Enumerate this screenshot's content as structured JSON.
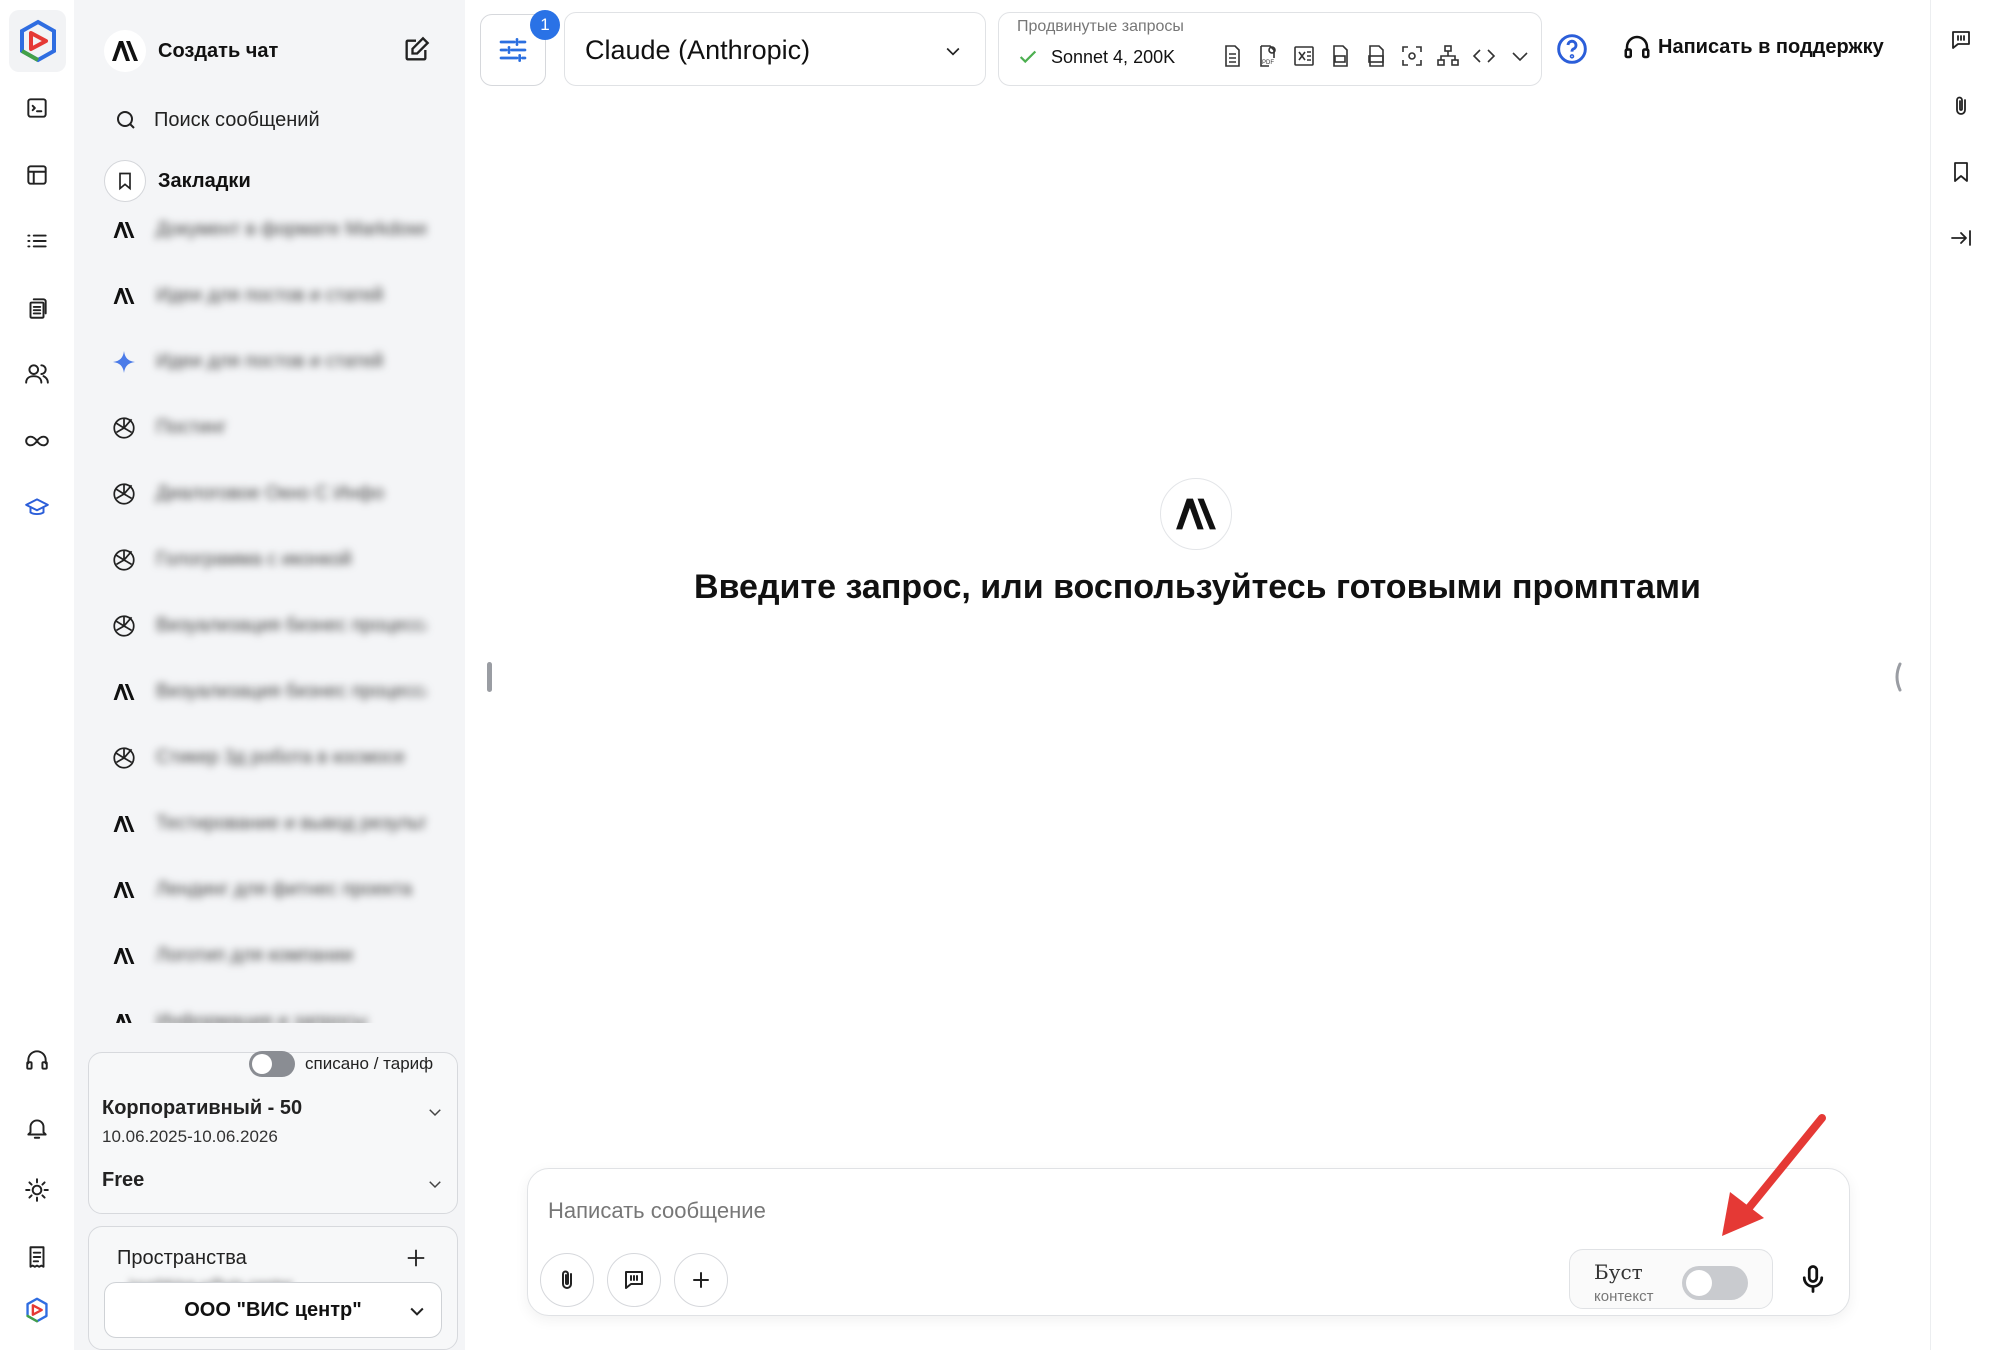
{
  "sidebar": {
    "new_chat_label": "Создать чат",
    "search_label": "Поиск сообщений",
    "bookmarks_label": "Закладки",
    "chats": [
      {
        "model": "anthropic",
        "title": "Документ в формате Markdown"
      },
      {
        "model": "anthropic",
        "title": "Идеи для постов и статей"
      },
      {
        "model": "gemini",
        "title": "Идеи для постов и статей"
      },
      {
        "model": "openai",
        "title": "Постинг"
      },
      {
        "model": "openai",
        "title": "Диалоговое Окно С Инфо"
      },
      {
        "model": "openai",
        "title": "Голограмма с иконкой"
      },
      {
        "model": "openai",
        "title": "Визуализация бизнес процесса"
      },
      {
        "model": "anthropic",
        "title": "Визуализация бизнес процесса"
      },
      {
        "model": "openai",
        "title": "Стикер 3д робота в космосе"
      },
      {
        "model": "anthropic",
        "title": "Тестирование и вывод результатов"
      },
      {
        "model": "anthropic",
        "title": "Лендинг для фитнес проекта"
      },
      {
        "model": "anthropic",
        "title": "Логотип для компании"
      },
      {
        "model": "anthropic",
        "title": "Информация и запросы"
      }
    ],
    "toggle_label": "списано / тариф",
    "plan_name": "Корпоративный - 50",
    "plan_dates": "10.06.2025-10.06.2026",
    "plan_free": "Free",
    "spaces_title": "Пространства",
    "spaces_email": "ivushkina.v@vis.center",
    "org_name": "ООО \"ВИС центр\""
  },
  "topbar": {
    "settings_badge": "1",
    "model_name": "Claude (Anthropic)",
    "advanced_label": "Продвинутые запросы",
    "advanced_model": "Sonnet 4, 200K",
    "support_label": "Написать в поддержку"
  },
  "main": {
    "headline": "Введите запрос, или воспользуйтесь готовыми промптами"
  },
  "composer": {
    "placeholder": "Написать сообщение",
    "boost_title": "Буст",
    "boost_subtitle": "контекст"
  },
  "colors": {
    "accent": "#2a72e6",
    "arrow": "#e53935",
    "check": "#4caf50"
  }
}
